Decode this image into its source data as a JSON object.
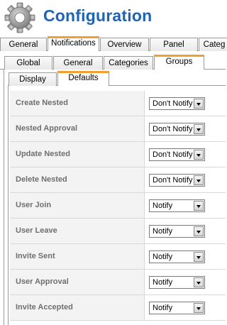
{
  "header": {
    "title": "Configuration",
    "icon": "gear-icon"
  },
  "tabs_main": [
    "General",
    "Notifications",
    "Overview",
    "Panel",
    "Categ"
  ],
  "tabs_sub": [
    "Global",
    "General",
    "Categories",
    "Groups"
  ],
  "tabs_inner": [
    "Display",
    "Defaults"
  ],
  "accent_color": "#f0a030",
  "title_color": "#1e64b4",
  "settings": [
    {
      "label": "Create Nested",
      "value": "Don't Notify"
    },
    {
      "label": "Nested Approval",
      "value": "Don't Notify"
    },
    {
      "label": "Update Nested",
      "value": "Don't Notify"
    },
    {
      "label": "Delete Nested",
      "value": "Don't Notify"
    },
    {
      "label": "User Join",
      "value": "Notify"
    },
    {
      "label": "User Leave",
      "value": "Notify"
    },
    {
      "label": "Invite Sent",
      "value": "Notify"
    },
    {
      "label": "User Approval",
      "value": "Notify"
    },
    {
      "label": "Invite Accepted",
      "value": "Notify"
    }
  ]
}
